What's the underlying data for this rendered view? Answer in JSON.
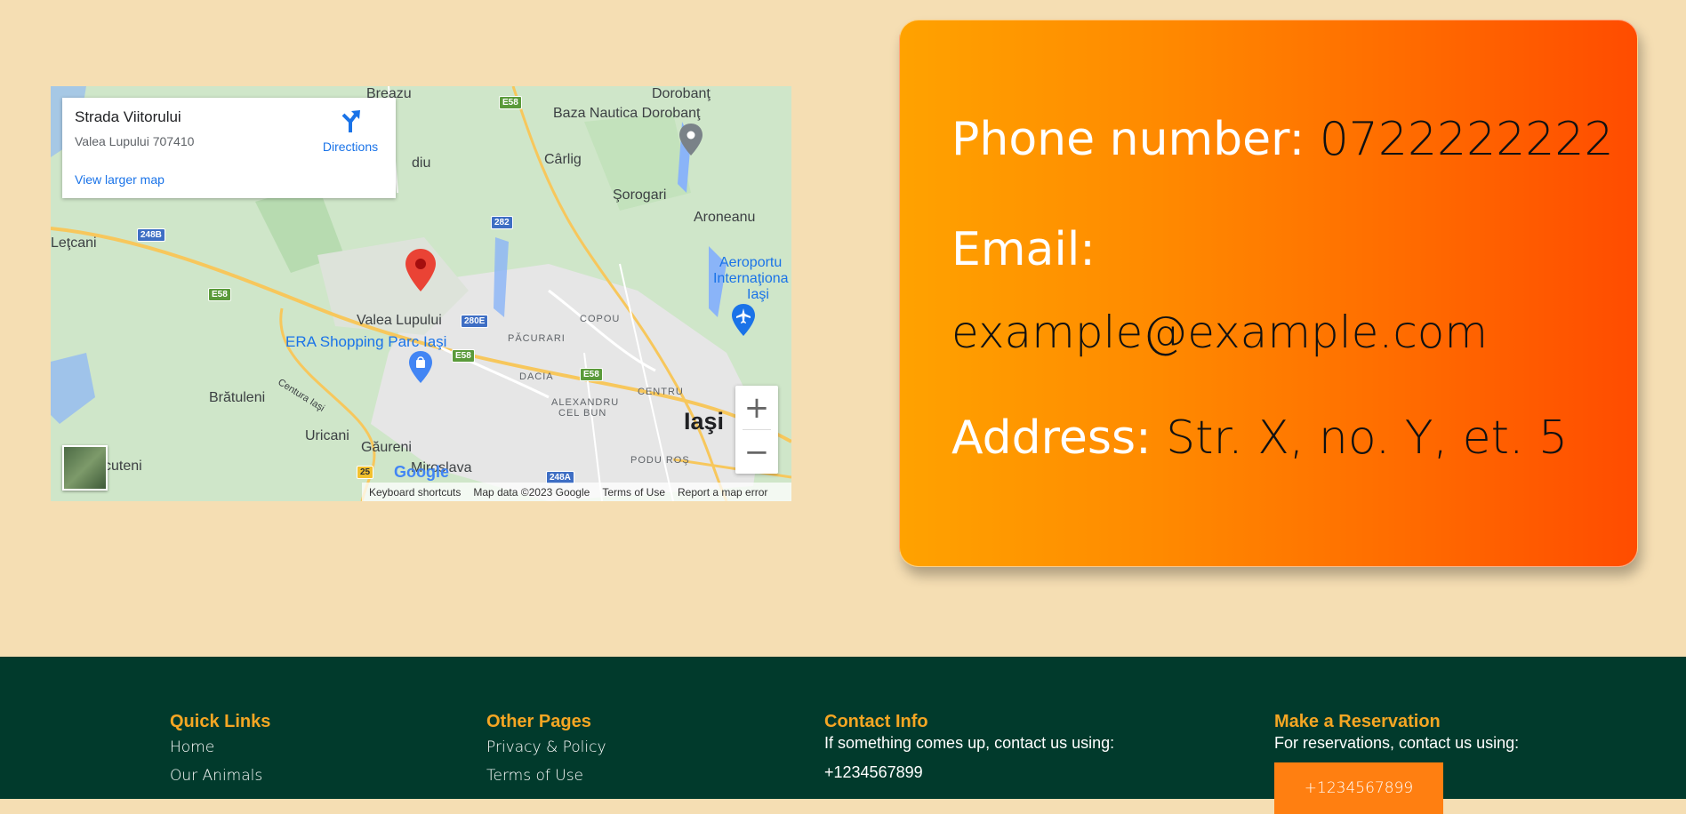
{
  "map": {
    "info_card": {
      "title": "Strada Viitorului",
      "address": "Valea Lupului 707410",
      "directions_label": "Directions",
      "larger_map_label": "View larger map"
    },
    "places": {
      "breazu": "Breazu",
      "dorobant": "Dorobanţ",
      "baza_nautica": "Baza Nautica Dorobanţ",
      "carlig": "Cârlig",
      "sorogari": "Şorogari",
      "aroneanu": "Aroneanu",
      "letcani": "Leţcani",
      "valea_lupului": "Valea Lupului",
      "era_shopping": "ERA Shopping Parc Iaşi",
      "aeroport_1": "Aeroportu",
      "aeroport_2": "Internaţiona",
      "aeroport_3": "Iaşi",
      "copou": "COPOU",
      "pacurari": "PĂCURARI",
      "dacia": "DACIA",
      "centru": "CENTRU",
      "alexandru_1": "ALEXANDRU",
      "alexandru_2": "CEL BUN",
      "podu_ros": "PODU ROŞ",
      "iasi": "Iaşi",
      "bratuleni": "Brătuleni",
      "uricani": "Uricani",
      "gaureni": "Găureni",
      "miroslava": "Miroslava",
      "cuteni": "cuteni",
      "centura": "Centura Iaşi",
      "diu": "diu"
    },
    "shields": {
      "e58_top": "E58",
      "r282": "282",
      "r248b": "248B",
      "e58_left": "E58",
      "r280e": "280E",
      "e58_mid": "E58",
      "e58_right": "E58",
      "r25": "25",
      "r248a": "248A"
    },
    "zoom_in": "+",
    "zoom_out": "−",
    "google": "Google",
    "attribution": {
      "shortcuts": "Keyboard shortcuts",
      "map_data": "Map data ©2023 Google",
      "terms": "Terms of Use",
      "report": "Report a map error"
    },
    "colors": {
      "land": "#cfe6c9",
      "urban": "#e8e8e8",
      "water": "#8ab4f8",
      "road": "#f7c75c",
      "pin": "#ea4335"
    }
  },
  "contact_card": {
    "phone_label": "Phone number:",
    "phone_value": "0722222222",
    "email_label": "Email:",
    "email_value": "example@example.com",
    "address_label": "Address:",
    "address_value": "Str. X, no. Y, et. 5",
    "gradient_start": "#ffa200",
    "gradient_end": "#ff4c00"
  },
  "footer": {
    "background": "#013a2c",
    "accent": "#f5a623",
    "quick_links": {
      "heading": "Quick Links",
      "items": [
        "Home",
        "Our Animals"
      ]
    },
    "other_pages": {
      "heading": "Other Pages",
      "items": [
        "Privacy & Policy",
        "Terms of Use"
      ]
    },
    "contact_info": {
      "heading": "Contact Info",
      "text": "If something comes up, contact us using:",
      "phone": "+1234567899"
    },
    "reservation": {
      "heading": "Make a Reservation",
      "text": "For reservations, contact us using:",
      "button_label": "+1234567899",
      "button_color": "#ff7f11"
    }
  }
}
